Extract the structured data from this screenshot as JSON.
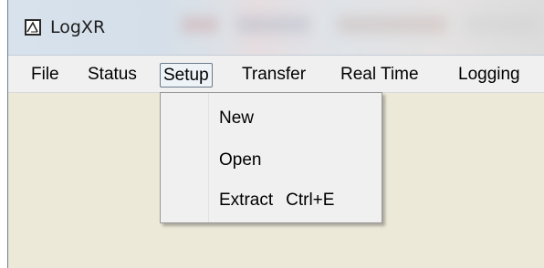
{
  "window": {
    "title": "LogXR",
    "icon": "chart-icon"
  },
  "menubar": {
    "items": [
      {
        "label": "File"
      },
      {
        "label": "Status"
      },
      {
        "label": "Setup",
        "active": true
      },
      {
        "label": "Transfer"
      },
      {
        "label": "Real Time"
      },
      {
        "label": "Logging"
      }
    ]
  },
  "setup_menu": {
    "items": [
      {
        "label": "New",
        "shortcut": ""
      },
      {
        "label": "Open",
        "shortcut": ""
      },
      {
        "label": "Extract",
        "shortcut": "Ctrl+E"
      }
    ]
  },
  "colors": {
    "client_background": "#ece9d8",
    "menubar_background": "#f0f0f0",
    "active_menu_border": "#6b7a8a"
  }
}
